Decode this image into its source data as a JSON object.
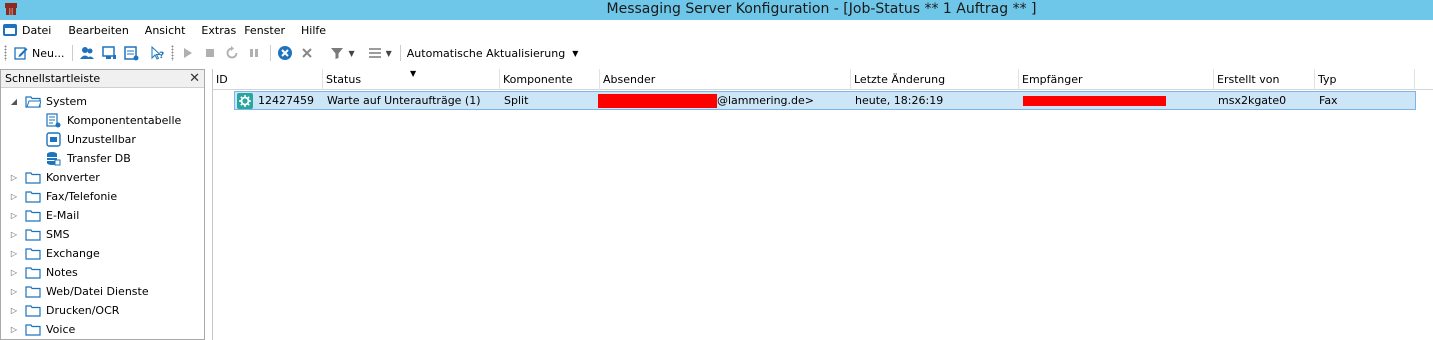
{
  "window": {
    "title": "Messaging Server Konfiguration - [Job-Status  ** 1 Auftrag  ** ]",
    "app_icon": "app-logo-icon"
  },
  "menu": {
    "items": [
      "Datei",
      "Bearbeiten",
      "Ansicht",
      "Extras",
      "Fenster",
      "Hilfe"
    ]
  },
  "toolbar": {
    "new_label": "Neu...",
    "auto_refresh_label": "Automatische Aktualisierung",
    "icons": [
      "new-icon",
      "users-icon",
      "console-icon",
      "list-icon",
      "help-pointer-icon",
      "play-icon",
      "stop-icon",
      "refresh-icon",
      "pause-icon",
      "cancel-circle-icon",
      "delete-x-icon",
      "filter-icon",
      "columns-icon"
    ]
  },
  "sidebar": {
    "title": "Schnellstartleiste",
    "close": "✕",
    "root": {
      "label": "System",
      "children": [
        "Komponententabelle",
        "Unzustellbar",
        "Transfer DB"
      ]
    },
    "folders": [
      "Konverter",
      "Fax/Telefonie",
      "E-Mail",
      "SMS",
      "Exchange",
      "Notes",
      "Web/Datei Dienste",
      "Drucken/OCR",
      "Voice"
    ]
  },
  "grid": {
    "columns": [
      "ID",
      "Status",
      "Komponente",
      "Absender",
      "Letzte Änderung",
      "Empfänger",
      "Erstellt von",
      "Typ"
    ],
    "rows": [
      {
        "id": "12427459",
        "status": "Warte auf Unteraufträge (1)",
        "komponente": "Split",
        "absender": "@lammering.de>",
        "letzte_aenderung": "heute, 18:26:19",
        "empfaenger": "",
        "erstellt_von": "msx2kgate0",
        "typ": "Fax"
      }
    ]
  },
  "colors": {
    "titlebar": "#6ec6e8",
    "selected_row": "#cde6f7",
    "redaction": "#ff0000"
  }
}
